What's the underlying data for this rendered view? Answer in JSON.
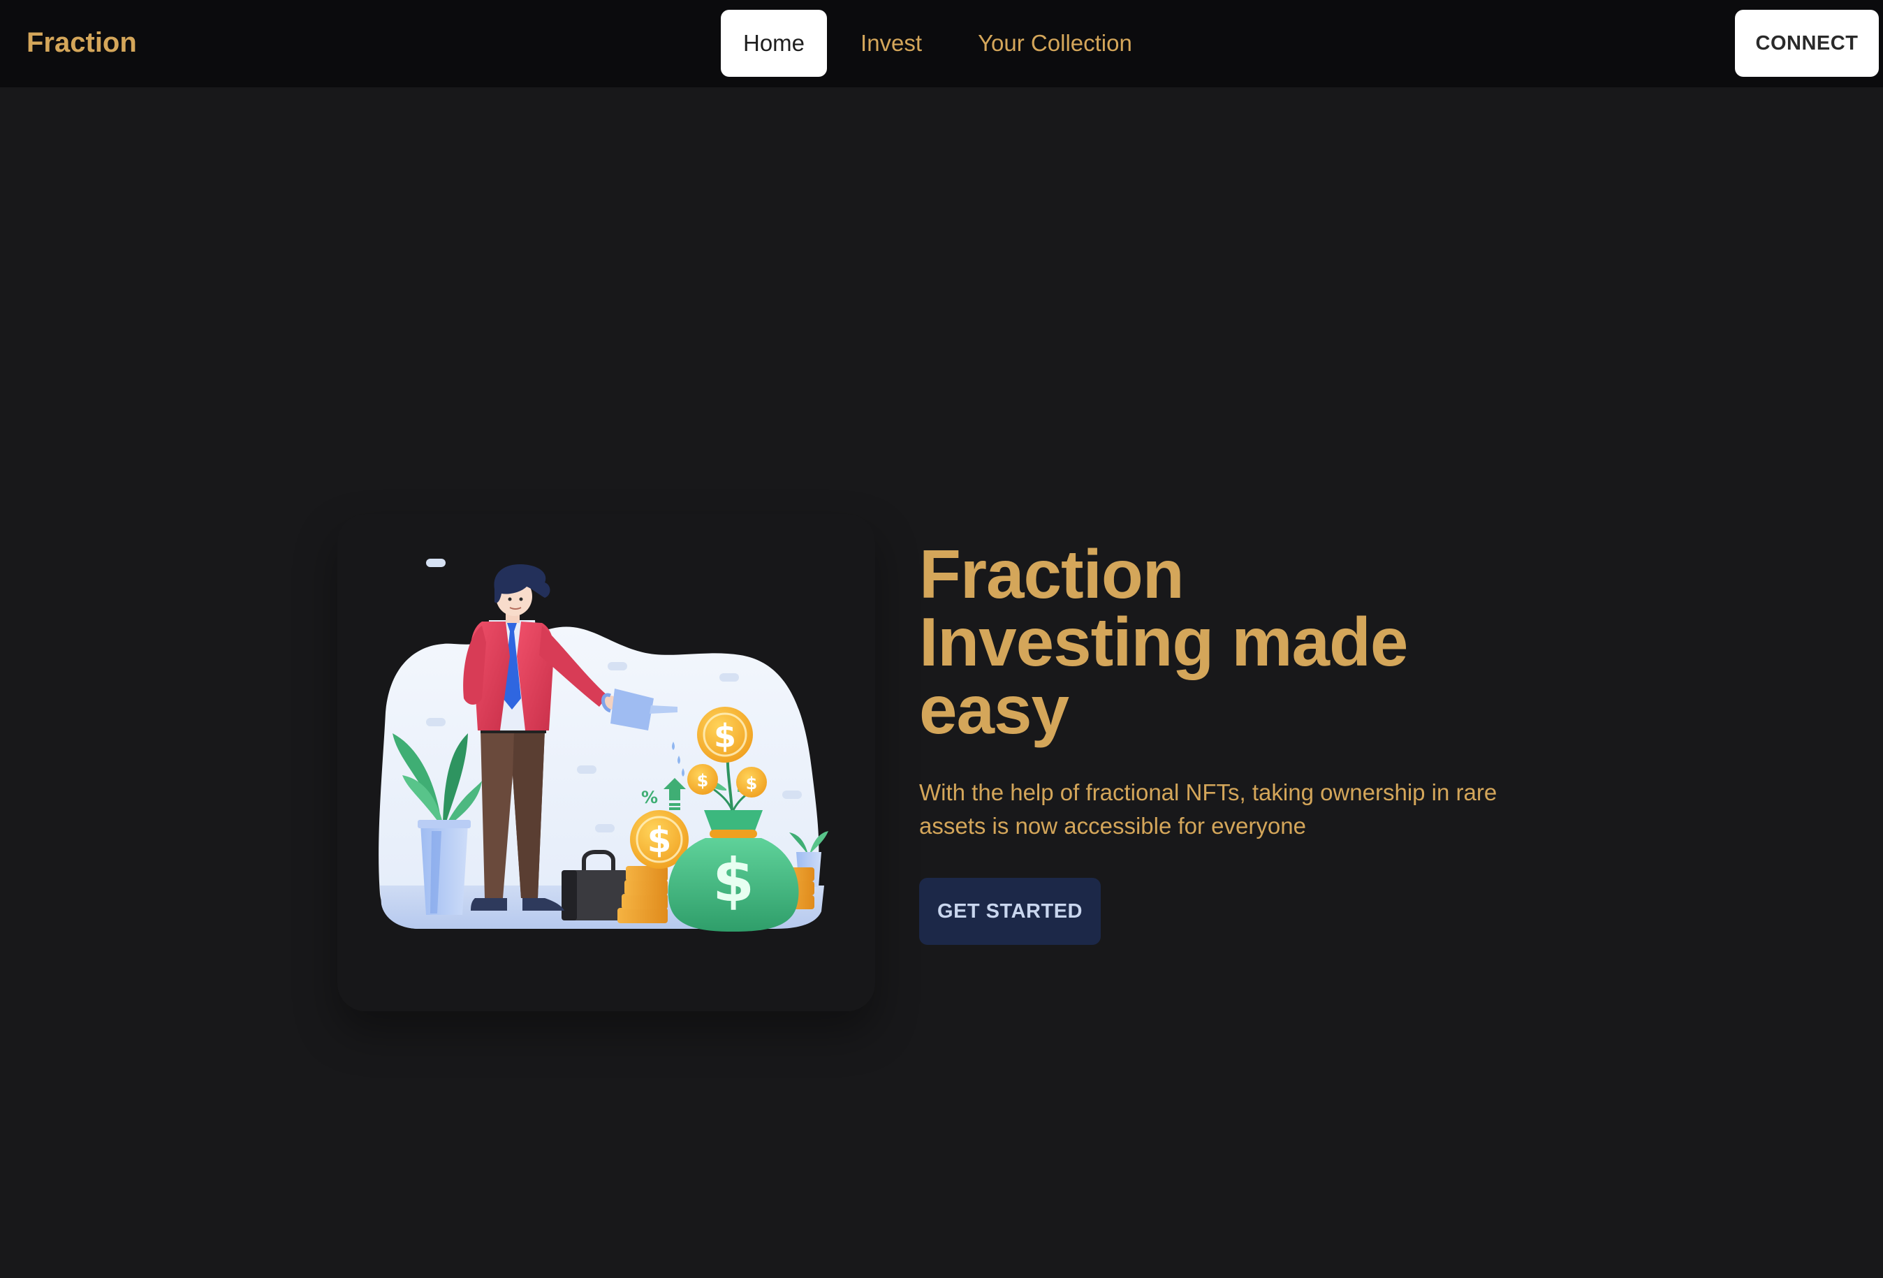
{
  "navbar": {
    "brand": "Fraction",
    "links": [
      {
        "label": "Home",
        "active": true
      },
      {
        "label": "Invest",
        "active": false
      },
      {
        "label": "Your Collection",
        "active": false
      }
    ],
    "connect_label": "CONNECT"
  },
  "hero": {
    "title_lines": [
      "Fraction",
      "Investing made",
      "easy"
    ],
    "subtitle_lines": [
      "With the help of fractional NFTs, taking ownership in rare",
      "assets is now accessible for everyone"
    ],
    "cta_label": "GET STARTED",
    "illustration": {
      "icon": "investor-watering-money-plant-icon",
      "currency_symbol": "$",
      "percent_symbol": "%"
    }
  },
  "colors": {
    "background": "#18181a",
    "navbar_bg": "#0b0b0d",
    "accent_gold": "#d4a65a",
    "cta_bg": "#1c2848",
    "cta_text": "#c9d6ee",
    "active_tab_bg": "#ffffff"
  }
}
